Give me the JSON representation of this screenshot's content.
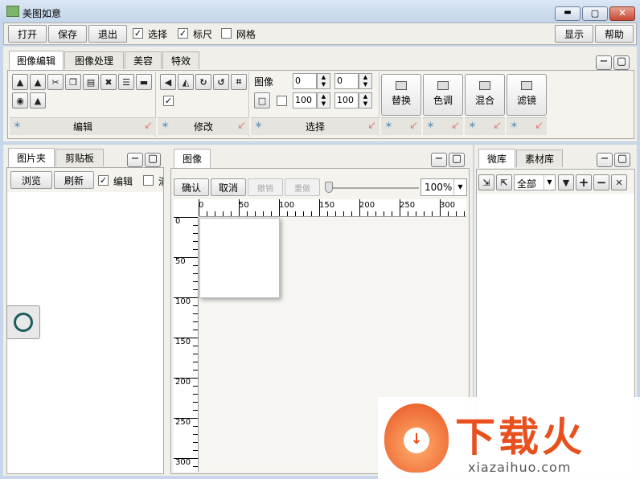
{
  "window": {
    "title": "美图如意"
  },
  "toolbar": {
    "open": "打开",
    "save": "保存",
    "exit": "退出",
    "select": "选择",
    "ruler": "标尺",
    "grid": "网格",
    "display": "显示",
    "help": "帮助"
  },
  "tabs": [
    "图像编辑",
    "图像处理",
    "美容",
    "特效"
  ],
  "groups": {
    "edit": "编辑",
    "modify": "修改",
    "select": "选择"
  },
  "select_panel": {
    "image_label": "图像",
    "x": "0",
    "y": "0",
    "w": "100",
    "h": "100"
  },
  "big_buttons": [
    "替换",
    "色调",
    "混合",
    "滤镜"
  ],
  "left_panel": {
    "tabs": [
      "图片夹",
      "剪贴板"
    ],
    "browse": "浏览",
    "refresh": "刷新",
    "edit": "编辑",
    "clear": "清"
  },
  "center_panel": {
    "tab": "图像",
    "confirm": "确认",
    "cancel": "取消",
    "undo": "撤销",
    "redo": "重做",
    "zoom": "100%",
    "hruler": [
      "0",
      "50",
      "100",
      "150",
      "200",
      "250",
      "300"
    ],
    "vruler": [
      "0",
      "50",
      "100",
      "150",
      "200",
      "250",
      "300"
    ]
  },
  "right_panel": {
    "tabs": [
      "微库",
      "素材库"
    ],
    "filter": "全部"
  },
  "watermark": {
    "brand": "下载火",
    "url": "xiazaihuo.com"
  }
}
